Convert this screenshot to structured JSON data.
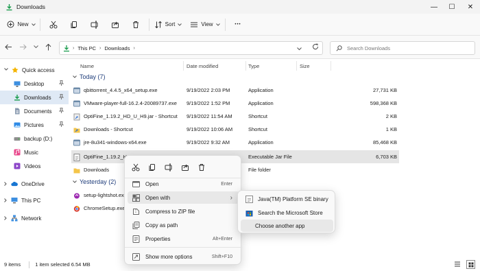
{
  "window": {
    "title": "Downloads",
    "minimize_glyph": "—",
    "maximize_glyph": "☐",
    "close_glyph": "✕"
  },
  "toolbar": {
    "new_label": "New",
    "sort_label": "Sort",
    "view_label": "View",
    "more_glyph": "•••"
  },
  "address": {
    "segments": [
      "This PC",
      "Downloads"
    ],
    "search_placeholder": "Search Downloads"
  },
  "sidebar": {
    "items": [
      {
        "label": "Quick access",
        "icon": "star-icon"
      },
      {
        "label": "Desktop",
        "icon": "desktop-icon",
        "pinned": true
      },
      {
        "label": "Downloads",
        "icon": "download-icon",
        "pinned": true,
        "selected": true
      },
      {
        "label": "Documents",
        "icon": "document-icon",
        "pinned": true
      },
      {
        "label": "Pictures",
        "icon": "pictures-icon",
        "pinned": true
      },
      {
        "label": "backup (D:)",
        "icon": "drive-icon"
      },
      {
        "label": "Music",
        "icon": "music-icon"
      },
      {
        "label": "Videos",
        "icon": "videos-icon"
      },
      {
        "label": "OneDrive",
        "icon": "cloud-icon"
      },
      {
        "label": "This PC",
        "icon": "computer-icon"
      },
      {
        "label": "Network",
        "icon": "network-icon"
      }
    ]
  },
  "columns": {
    "name": "Name",
    "date": "Date modified",
    "type": "Type",
    "size": "Size"
  },
  "groups": {
    "today": "Today (7)",
    "yesterday": "Yesterday (2)"
  },
  "files": [
    {
      "name": "qbittorrent_4.4.5_x64_setup.exe",
      "date": "9/19/2022 2:03 PM",
      "type": "Application",
      "size": "27,731 KB",
      "icon": "exe-icon"
    },
    {
      "name": "VMware-player-full-16.2.4-20089737.exe",
      "date": "9/19/2022 1:52 PM",
      "type": "Application",
      "size": "598,368 KB",
      "icon": "exe-icon"
    },
    {
      "name": "OptiFine_1.19.2_HD_U_H9.jar - Shortcut",
      "date": "9/19/2022 11:54 AM",
      "type": "Shortcut",
      "size": "2 KB",
      "icon": "shortcut-icon"
    },
    {
      "name": "Downloads - Shortcut",
      "date": "9/19/2022 10:06 AM",
      "type": "Shortcut",
      "size": "1 KB",
      "icon": "shortcut-icon"
    },
    {
      "name": "jre-8u341-windows-x64.exe",
      "date": "9/19/2022 9:32 AM",
      "type": "Application",
      "size": "85,468 KB",
      "icon": "exe-icon"
    },
    {
      "name": "OptiFine_1.19.2_H",
      "date": "",
      "type": "Executable Jar File",
      "size": "6,703 KB",
      "icon": "jar-icon"
    },
    {
      "name": "Downloads",
      "date": "",
      "type": "File folder",
      "size": "",
      "icon": "folder-icon"
    }
  ],
  "files_yesterday": [
    {
      "name": "setup-lightshot.exe",
      "icon": "exe-icon"
    },
    {
      "name": "ChromeSetup.exe",
      "icon": "exe-icon"
    }
  ],
  "context_menu": {
    "items": [
      {
        "label": "Open",
        "accel": "Enter"
      },
      {
        "label": "Open with",
        "accel": "›"
      },
      {
        "label": "Compress to ZIP file",
        "accel": ""
      },
      {
        "label": "Copy as path",
        "accel": ""
      },
      {
        "label": "Properties",
        "accel": "Alt+Enter"
      },
      {
        "label": "Show more options",
        "accel": "Shift+F10"
      }
    ]
  },
  "submenu": {
    "items": [
      {
        "label": "Java(TM) Platform SE binary"
      },
      {
        "label": "Search the Microsoft Store"
      },
      {
        "label": "Choose another app"
      }
    ]
  },
  "status": {
    "count": "9 items",
    "selection": "1 item selected  6.54 MB"
  },
  "colors": {
    "accent": "#0067c0",
    "selected_row": "#cce8ff",
    "folder": "#f4c54a",
    "download_green": "#1a9c4d"
  }
}
